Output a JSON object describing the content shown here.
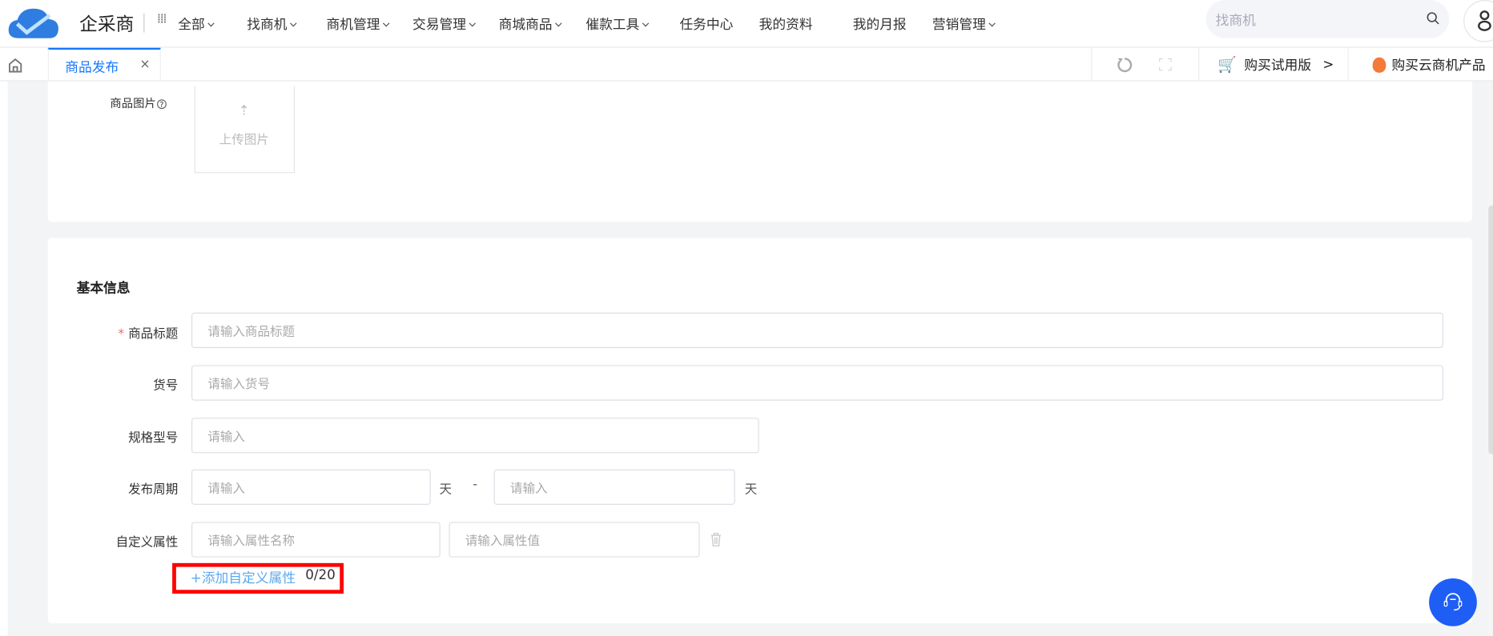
{
  "header": {
    "brand": "企采商",
    "all_label": "全部",
    "nav": [
      "找商机",
      "商机管理",
      "交易管理",
      "商城商品",
      "催款工具",
      "任务中心",
      "我的资料",
      "我的月报",
      "营销管理"
    ],
    "nav_has_dropdown": [
      true,
      true,
      true,
      true,
      true,
      false,
      false,
      false,
      true
    ],
    "search_placeholder": "找商机"
  },
  "tabs": {
    "active": "商品发布",
    "close": "×",
    "trial": "购买试用版",
    "trial_arrow": ">",
    "cloud": "购买云商机产品"
  },
  "image_section": {
    "label": "商品图片",
    "help": "?",
    "upload": "上传图片"
  },
  "basic": {
    "title": "基本信息",
    "required_mark": "*",
    "title_label": "商品标题",
    "title_placeholder": "请输入商品标题",
    "sku_label": "货号",
    "sku_placeholder": "请输入货号",
    "model_label": "规格型号",
    "model_placeholder": "请输入",
    "cycle_label": "发布周期",
    "cycle_from_placeholder": "请输入",
    "cycle_to_placeholder": "请输入",
    "day_unit": "天",
    "dash": "-",
    "attr_label": "自定义属性",
    "attr_name_placeholder": "请输入属性名称",
    "attr_value_placeholder": "请输入属性值",
    "add_attr": "+添加自定义属性",
    "attr_count": "0/20"
  },
  "colors": {
    "accent": "#1677ff",
    "link": "#5aa9f0",
    "highlight": "#ff0000",
    "help_button": "#1e5ef5"
  }
}
